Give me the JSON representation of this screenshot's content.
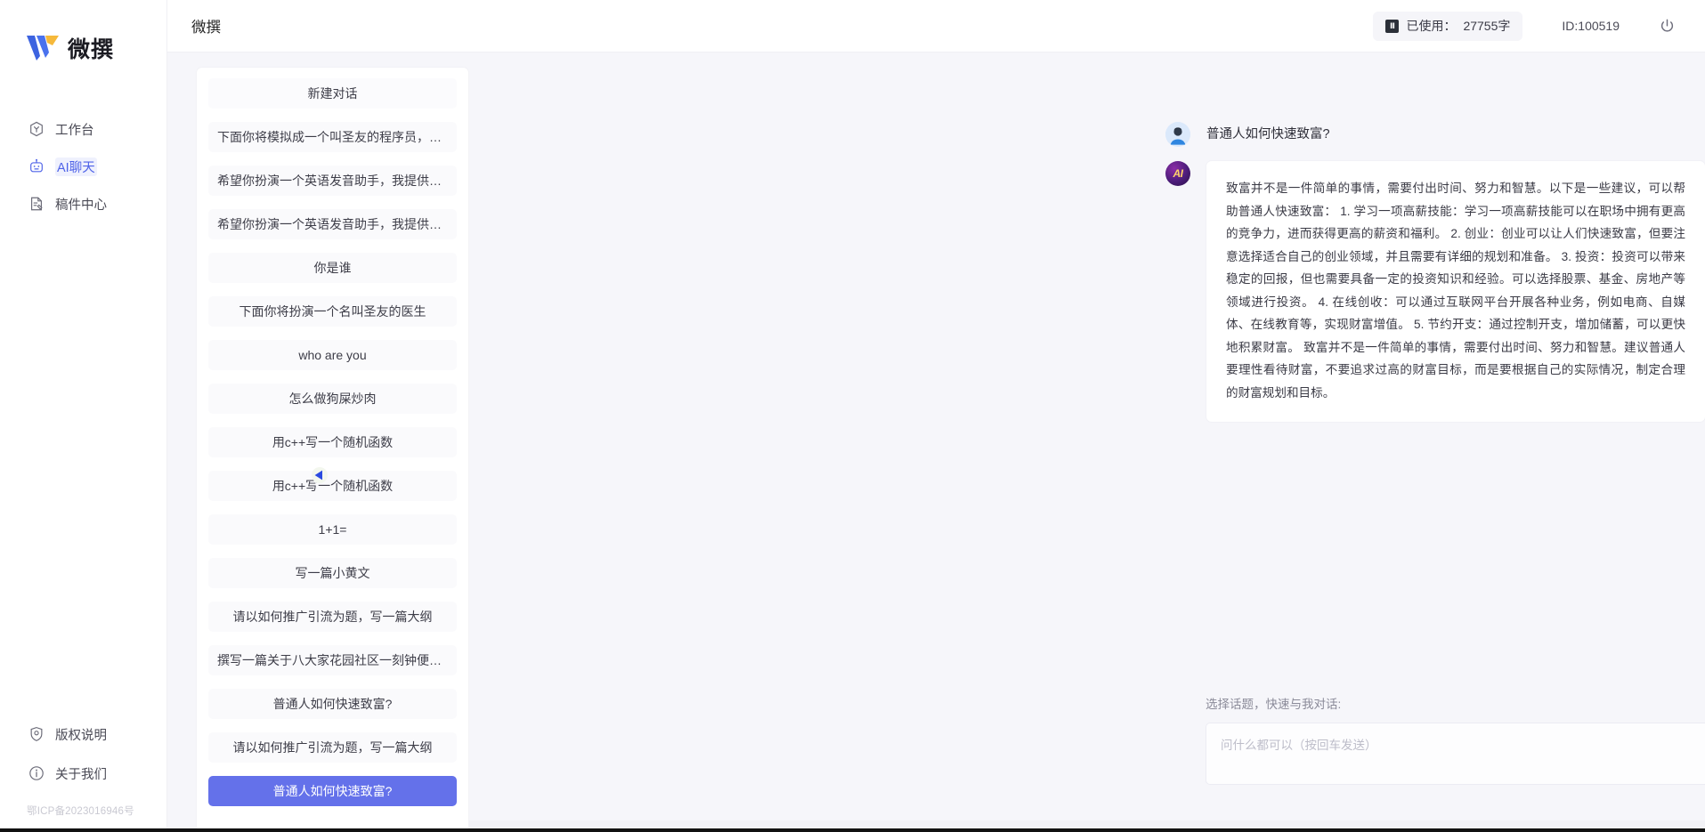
{
  "brand": {
    "name": "微撰",
    "logo_icon": "w-logo-icon"
  },
  "sidebar": {
    "items": [
      {
        "label": "工作台",
        "icon": "workbench-icon",
        "active": false
      },
      {
        "label": "AI聊天",
        "icon": "ai-chat-icon",
        "active": true
      },
      {
        "label": "稿件中心",
        "icon": "document-center-icon",
        "active": false
      }
    ],
    "bottom_items": [
      {
        "label": "版权说明",
        "icon": "shield-icon"
      },
      {
        "label": "关于我们",
        "icon": "info-icon"
      }
    ],
    "icp": "鄂ICP备2023016946号"
  },
  "header": {
    "title": "微撰",
    "usage_label": "已使用：",
    "usage_value": "27755字",
    "usage_icon": "token-icon",
    "user_id": "ID:100519",
    "power_icon": "power-icon"
  },
  "conversations": {
    "new_chat_label": "新建对话",
    "items": [
      {
        "label": "下面你将模拟成一个叫圣友的程序员，我说...",
        "selected": false
      },
      {
        "label": "希望你扮演一个英语发音助手，我提供给你...",
        "selected": false
      },
      {
        "label": "希望你扮演一个英语发音助手，我提供给你...",
        "selected": false
      },
      {
        "label": "你是谁",
        "selected": false
      },
      {
        "label": "下面你将扮演一个名叫圣友的医生",
        "selected": false
      },
      {
        "label": "who are you",
        "selected": false
      },
      {
        "label": "怎么做狗屎炒肉",
        "selected": false
      },
      {
        "label": "用c++写一个随机函数",
        "selected": false
      },
      {
        "label": "用c++写一个随机函数",
        "selected": false
      },
      {
        "label": "1+1=",
        "selected": false
      },
      {
        "label": "写一篇小黄文",
        "selected": false
      },
      {
        "label": "请以如何推广引流为题，写一篇大纲",
        "selected": false
      },
      {
        "label": "撰写一篇关于八大家花园社区一刻钟便民生...",
        "selected": false
      },
      {
        "label": "普通人如何快速致富?",
        "selected": false
      },
      {
        "label": "请以如何推广引流为题，写一篇大纲",
        "selected": false
      },
      {
        "label": "普通人如何快速致富?",
        "selected": true
      }
    ],
    "collapse_icon": "collapse-left-icon"
  },
  "chat": {
    "user_avatar_icon": "user-avatar-icon",
    "ai_avatar_label": "AI",
    "user_message": "普通人如何快速致富?",
    "ai_message": "致富并不是一件简单的事情，需要付出时间、努力和智慧。以下是一些建议，可以帮助普通人快速致富： 1. 学习一项高薪技能：学习一项高薪技能可以在职场中拥有更高的竞争力，进而获得更高的薪资和福利。 2. 创业：创业可以让人们快速致富，但要注意选择适合自己的创业领域，并且需要有详细的规划和准备。 3. 投资：投资可以带来稳定的回报，但也需要具备一定的投资知识和经验。可以选择股票、基金、房地产等领域进行投资。 4. 在线创收：可以通过互联网平台开展各种业务，例如电商、自媒体、在线教育等，实现财富增值。 5. 节约开支：通过控制开支，增加储蓄，可以更快地积累财富。 致富并不是一件简单的事情，需要付出时间、努力和智慧。建议普通人要理性看待财富，不要追求过高的财富目标，而是要根据自己的实际情况，制定合理的财富规划和目标。"
  },
  "composer": {
    "hint": "选择话题，快速与我对话:",
    "placeholder": "问什么都可以（按回车发送）",
    "send_icon": "send-plane-icon"
  },
  "colors": {
    "accent": "#6471ea",
    "page_bg": "#f6f6fa",
    "panel_bg": "#ffffff",
    "send_blue": "#3f6fe3"
  }
}
